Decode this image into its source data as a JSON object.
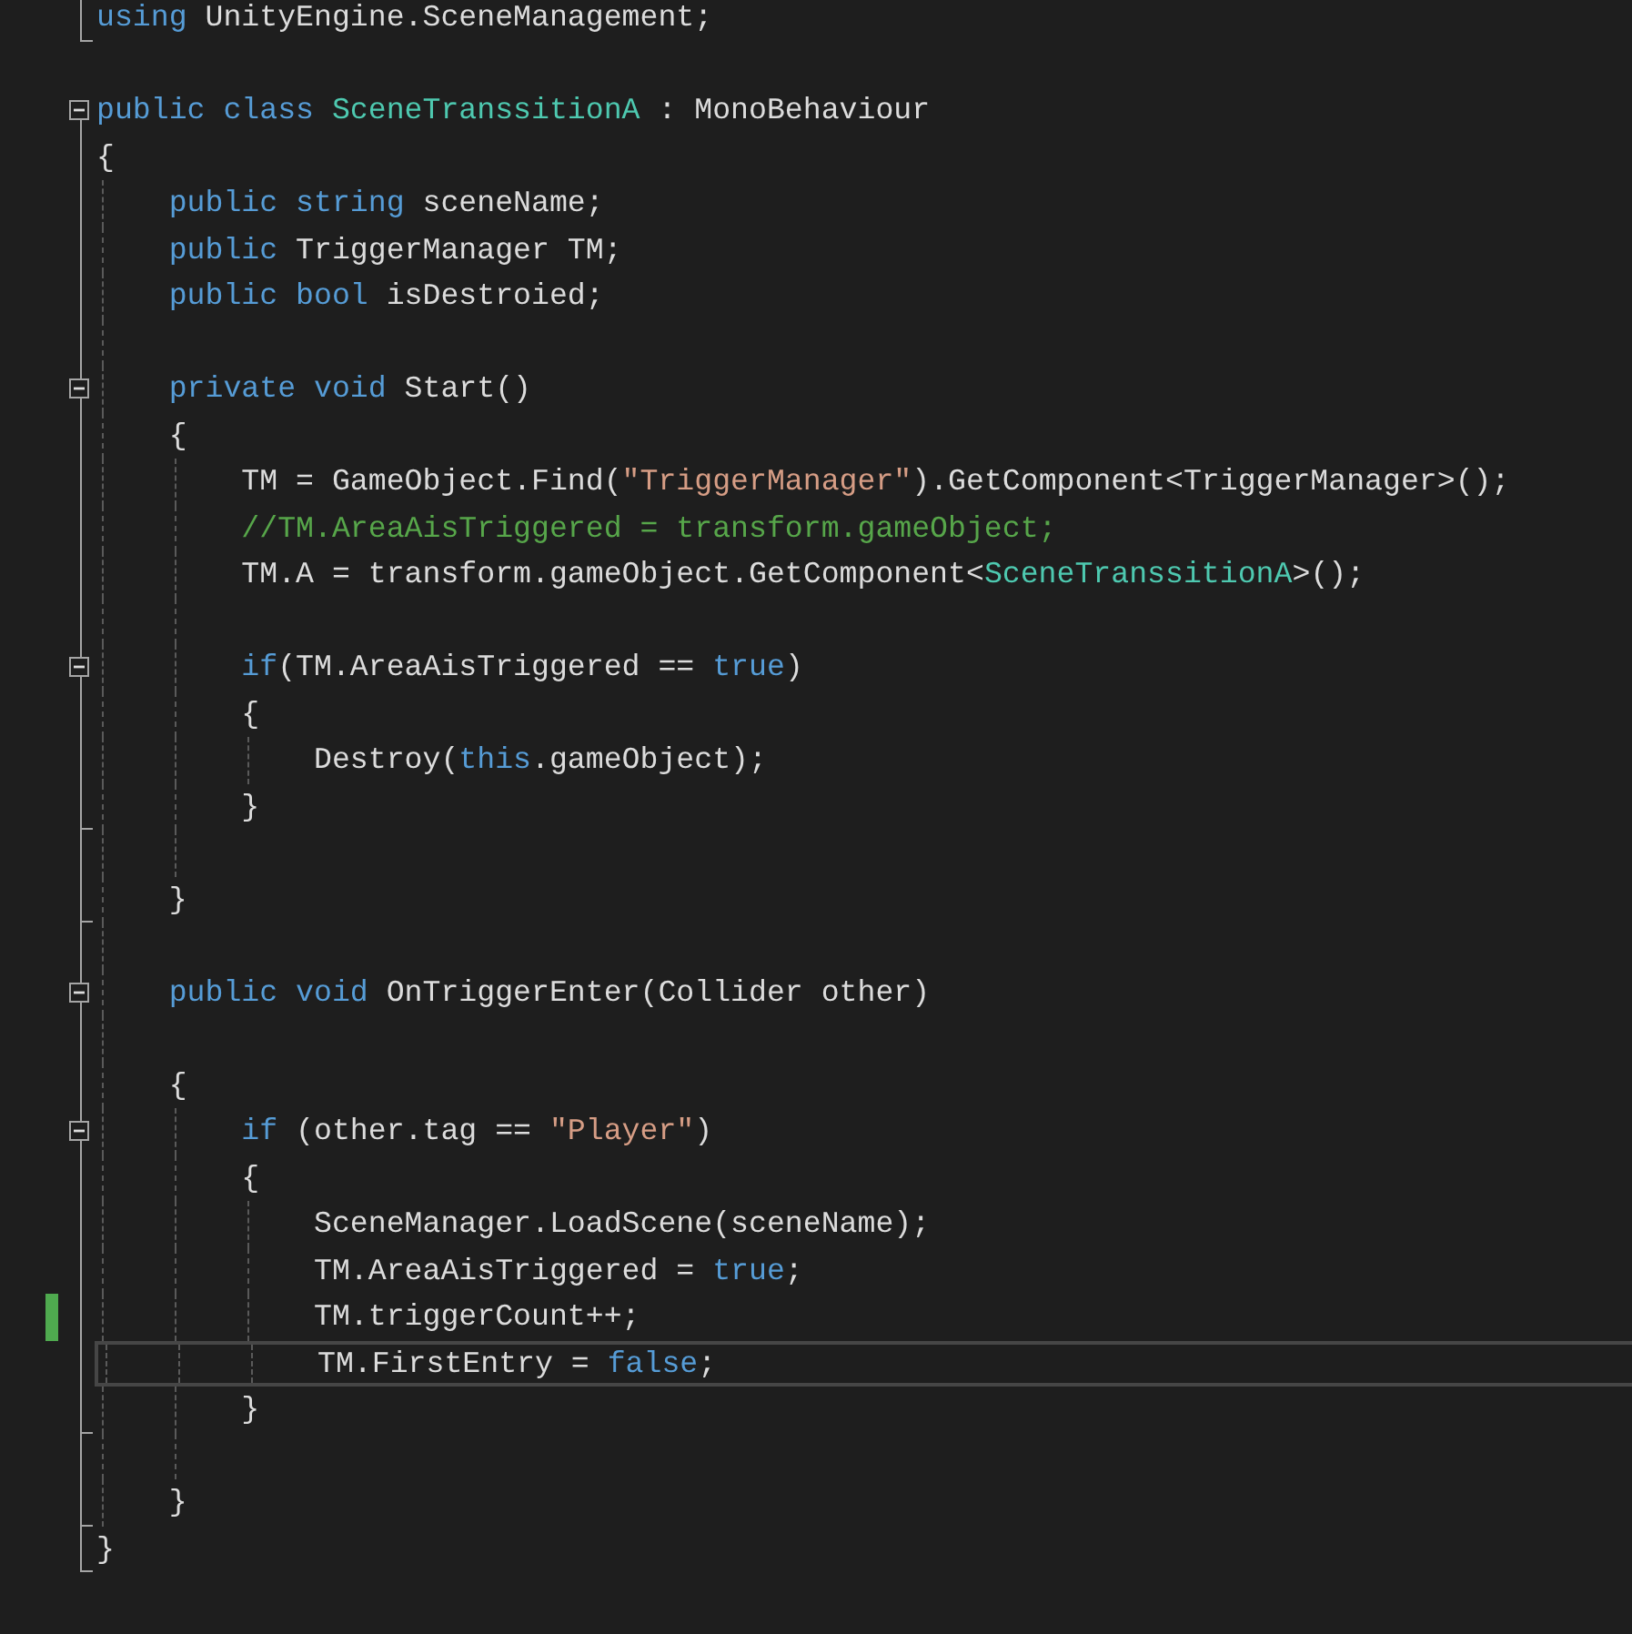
{
  "editor": {
    "lines": [
      {
        "block_end": true,
        "changed": false,
        "current": false,
        "tokens": [
          {
            "text": "using",
            "kind": "keyword"
          },
          {
            "text": " UnityEngine.SceneManagement;",
            "kind": "plain"
          }
        ]
      },
      {
        "changed": false,
        "current": false
      },
      {
        "expanded": true,
        "changed": false,
        "current": false,
        "tokens": [
          {
            "text": "public class",
            "kind": "keyword"
          },
          {
            "text": " SceneTranssitionA",
            "kind": "type"
          },
          {
            "text": " : MonoBehaviour",
            "kind": "plain"
          }
        ]
      },
      {
        "changed": false,
        "current": false,
        "tokens": [
          {
            "text": "{",
            "kind": "plain"
          }
        ]
      },
      {
        "changed": false,
        "current": false,
        "tokens": [
          {
            "text": "    public string",
            "kind": "keyword"
          },
          {
            "text": " sceneName;",
            "kind": "plain"
          }
        ]
      },
      {
        "changed": false,
        "current": false,
        "tokens": [
          {
            "text": "    public",
            "kind": "keyword"
          },
          {
            "text": " TriggerManager TM;",
            "kind": "plain"
          }
        ]
      },
      {
        "changed": false,
        "current": false,
        "tokens": [
          {
            "text": "    public bool",
            "kind": "keyword"
          },
          {
            "text": " isDestroied;",
            "kind": "plain"
          }
        ]
      },
      {
        "changed": false,
        "current": false
      },
      {
        "expanded": true,
        "changed": false,
        "current": false,
        "tokens": [
          {
            "text": "    private void",
            "kind": "keyword"
          },
          {
            "text": " Start()",
            "kind": "plain"
          }
        ]
      },
      {
        "changed": false,
        "current": false,
        "tokens": [
          {
            "text": "    {",
            "kind": "plain"
          }
        ]
      },
      {
        "changed": false,
        "current": false,
        "tokens": [
          {
            "text": "        TM = GameObject.Find(",
            "kind": "plain"
          },
          {
            "text": "\"TriggerManager\"",
            "kind": "string"
          },
          {
            "text": ").GetComponent<TriggerManager>();",
            "kind": "plain"
          }
        ]
      },
      {
        "changed": false,
        "current": false,
        "tokens": [
          {
            "text": "        //TM.AreaAisTriggered = transform.gameObject;",
            "kind": "comment"
          }
        ]
      },
      {
        "changed": false,
        "current": false,
        "tokens": [
          {
            "text": "        TM.A = transform.gameObject.GetComponent<",
            "kind": "plain"
          },
          {
            "text": "SceneTranssitionA",
            "kind": "type"
          },
          {
            "text": ">();",
            "kind": "plain"
          }
        ]
      },
      {
        "changed": false,
        "current": false
      },
      {
        "expanded": true,
        "changed": false,
        "current": false,
        "tokens": [
          {
            "text": "        if",
            "kind": "keyword"
          },
          {
            "text": "(TM.AreaAisTriggered == ",
            "kind": "plain"
          },
          {
            "text": "true",
            "kind": "keyword"
          },
          {
            "text": ")",
            "kind": "plain"
          }
        ]
      },
      {
        "changed": false,
        "current": false,
        "tokens": [
          {
            "text": "        {",
            "kind": "plain"
          }
        ]
      },
      {
        "changed": false,
        "current": false,
        "tokens": [
          {
            "text": "            Destroy(",
            "kind": "plain"
          },
          {
            "text": "this",
            "kind": "keyword"
          },
          {
            "text": ".gameObject);",
            "kind": "plain"
          }
        ]
      },
      {
        "block_end": true,
        "changed": false,
        "current": false,
        "tokens": [
          {
            "text": "        }",
            "kind": "plain"
          }
        ]
      },
      {
        "changed": false,
        "current": false
      },
      {
        "block_end": true,
        "changed": false,
        "current": false,
        "tokens": [
          {
            "text": "    }",
            "kind": "plain"
          }
        ]
      },
      {
        "changed": false,
        "current": false
      },
      {
        "expanded": true,
        "changed": false,
        "current": false,
        "tokens": [
          {
            "text": "    public void",
            "kind": "keyword"
          },
          {
            "text": " OnTriggerEnter(Collider other)",
            "kind": "plain"
          }
        ]
      },
      {
        "changed": false,
        "current": false
      },
      {
        "changed": false,
        "current": false,
        "tokens": [
          {
            "text": "    {",
            "kind": "plain"
          }
        ]
      },
      {
        "expanded": true,
        "changed": false,
        "current": false,
        "tokens": [
          {
            "text": "        if",
            "kind": "keyword"
          },
          {
            "text": " (other.tag == ",
            "kind": "plain"
          },
          {
            "text": "\"Player\"",
            "kind": "string"
          },
          {
            "text": ")",
            "kind": "plain"
          }
        ]
      },
      {
        "changed": false,
        "current": false,
        "tokens": [
          {
            "text": "        {",
            "kind": "plain"
          }
        ]
      },
      {
        "changed": false,
        "current": false,
        "tokens": [
          {
            "text": "            SceneManager.LoadScene(sceneName);",
            "kind": "plain"
          }
        ]
      },
      {
        "changed": false,
        "current": false,
        "tokens": [
          {
            "text": "            TM.AreaAisTriggered = ",
            "kind": "plain"
          },
          {
            "text": "true",
            "kind": "keyword"
          },
          {
            "text": ";",
            "kind": "plain"
          }
        ]
      },
      {
        "changed": true,
        "current": false,
        "tokens": [
          {
            "text": "            TM.triggerCount++;",
            "kind": "plain"
          }
        ]
      },
      {
        "changed": false,
        "current": true,
        "tokens": [
          {
            "text": "            TM.FirstEntry = ",
            "kind": "plain"
          },
          {
            "text": "false",
            "kind": "keyword"
          },
          {
            "text": ";",
            "kind": "plain"
          }
        ]
      },
      {
        "block_end": true,
        "changed": false,
        "current": false,
        "tokens": [
          {
            "text": "        }",
            "kind": "plain"
          }
        ]
      },
      {
        "changed": false,
        "current": false
      },
      {
        "block_end": true,
        "changed": false,
        "current": false,
        "tokens": [
          {
            "text": "    }",
            "kind": "plain"
          }
        ]
      },
      {
        "block_end": true,
        "changed": false,
        "current": false,
        "tokens": [
          {
            "text": "}",
            "kind": "plain"
          }
        ]
      }
    ]
  }
}
